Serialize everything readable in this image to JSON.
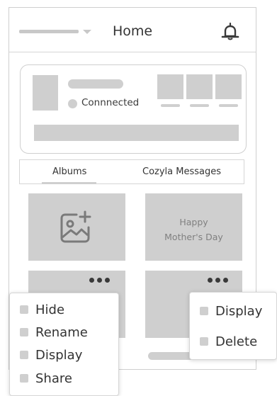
{
  "header": {
    "title": "Home",
    "bell_icon": "bell-icon"
  },
  "status_card": {
    "status_text": "Connnected"
  },
  "tabs": [
    {
      "label": "Albums",
      "active": true
    },
    {
      "label": "Cozyla Messages",
      "active": false
    }
  ],
  "albums": [
    {
      "type": "add",
      "icon": "add-image-icon"
    },
    {
      "type": "text",
      "label": "Happy Mother's Day"
    }
  ],
  "menu_left": {
    "items": [
      "Hide",
      "Rename",
      "Display",
      "Share"
    ]
  },
  "menu_right": {
    "items": [
      "Display",
      "Delete"
    ]
  },
  "colors": {
    "placeholder": "#cfcfcf",
    "border": "#d6d6d6",
    "text": "#333333"
  }
}
